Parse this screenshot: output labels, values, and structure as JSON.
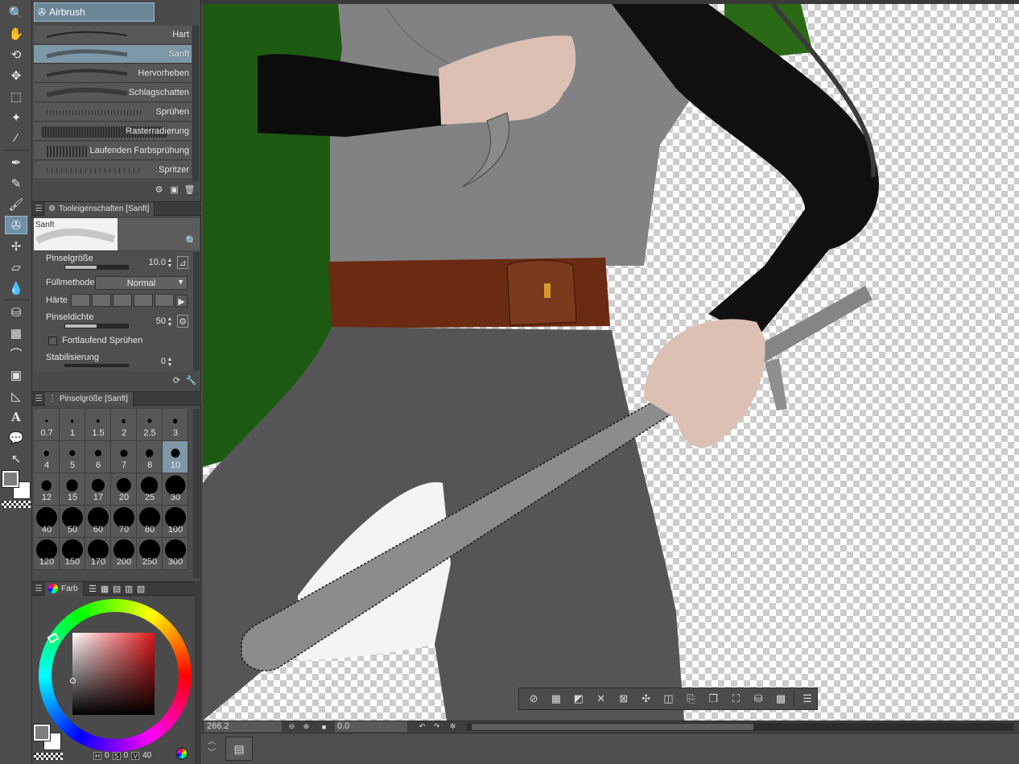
{
  "subtool": {
    "group_label": "Airbrush",
    "items": [
      {
        "label": "Hart"
      },
      {
        "label": "Sanft"
      },
      {
        "label": "Hervorheben"
      },
      {
        "label": "Schlagschatten"
      },
      {
        "label": "Sprühen"
      },
      {
        "label": "Rasterradierung"
      },
      {
        "label": "Laufenden Farbsprühung"
      },
      {
        "label": "Spritzer"
      }
    ],
    "selected_index": 1
  },
  "tool_property": {
    "tab_label": "Tooleigenschaften [Sanft]",
    "preview_label": "Sanft",
    "brush_size_label": "Pinselgröße",
    "brush_size_value": "10.0",
    "blend_label": "Füllmethode",
    "blend_value": "Normal",
    "hardness_label": "Härte",
    "density_label": "Pinseldichte",
    "density_value": "50",
    "continuous_spray_label": "Fortlaufend Sprühen",
    "stabilization_label": "Stabilisierung",
    "stabilization_value": "0"
  },
  "brush_size": {
    "tab_label": "Pinselgröße [Sanft]",
    "sizes": [
      "0.7",
      "1",
      "1.5",
      "2",
      "2.5",
      "3",
      "4",
      "5",
      "6",
      "7",
      "8",
      "10",
      "12",
      "15",
      "17",
      "20",
      "25",
      "30",
      "40",
      "50",
      "60",
      "70",
      "80",
      "100",
      "120",
      "150",
      "170",
      "200",
      "250",
      "300"
    ],
    "selected": "10"
  },
  "color": {
    "tab_label": "Farb",
    "main_color": "#7d7d7d",
    "sub_color": "#ffffff",
    "hue_value": "0",
    "saturation_value": "0",
    "value_value": "40",
    "h_key": "H",
    "s_key": "S",
    "v_key": "V"
  },
  "status": {
    "zoom": "266.2",
    "rotation": "0.0"
  },
  "tools": [
    "zoom-icon",
    "hand-icon",
    "rotate-icon",
    "move-layer-icon",
    "rect-select-icon",
    "magic-wand-icon",
    "eyedropper-icon",
    "pen-icon",
    "pencil-icon",
    "brush-icon",
    "airbrush-icon",
    "decoration-icon",
    "eraser-icon",
    "blend-icon",
    "fill-icon",
    "gradient-icon",
    "curve-icon",
    "frame-icon",
    "ruler-icon",
    "text-icon",
    "balloon-icon",
    "correct-line-icon"
  ],
  "colors": {
    "panel_bg": "#4a4a4a",
    "selection_blue": "#7e98a8",
    "cloak_green": "#1f5c12",
    "shirt_gray": "#808082",
    "pants_gray": "#555558",
    "sleeve_black": "#0a0a0a",
    "belt_brown": "#6b2a12",
    "skin": "#dcc0b3"
  }
}
